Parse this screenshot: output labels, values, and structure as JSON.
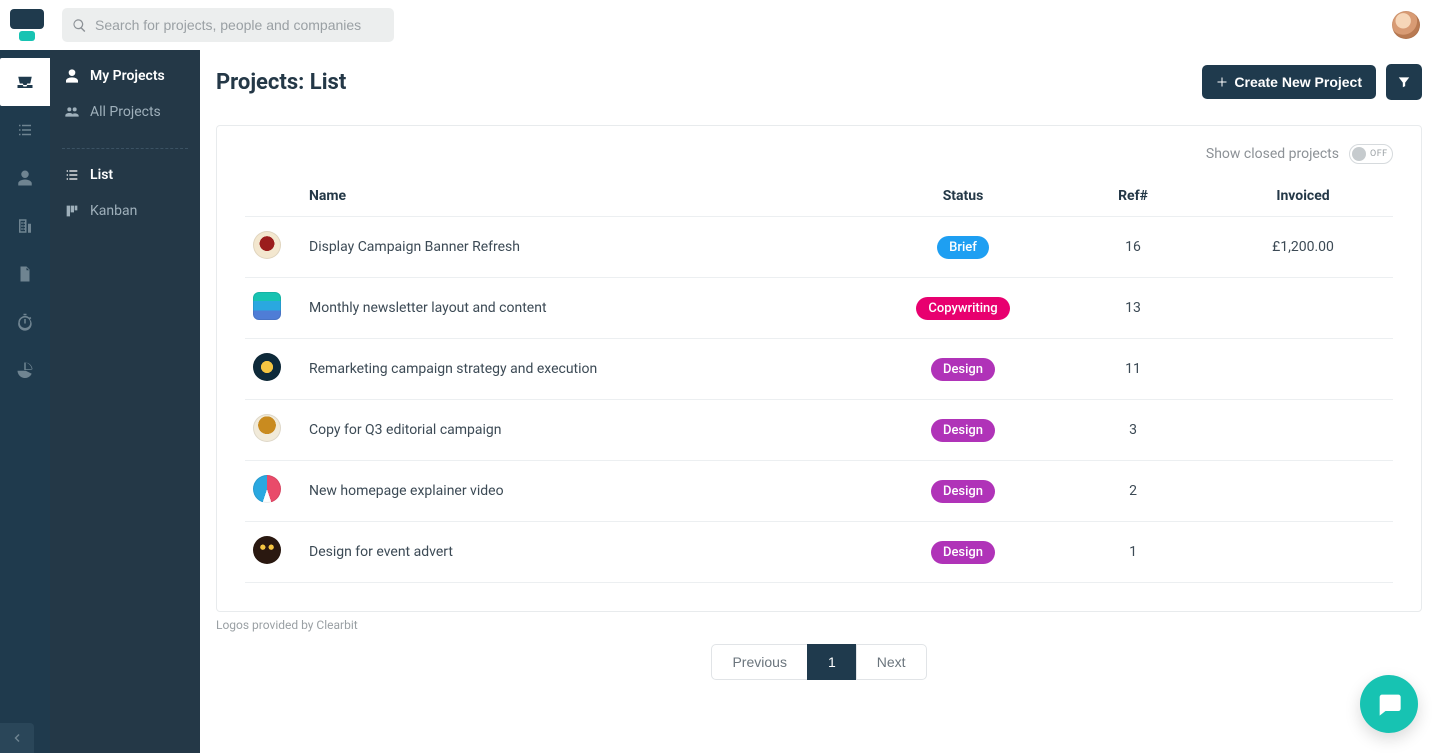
{
  "search": {
    "placeholder": "Search for projects, people and companies"
  },
  "sidebar": {
    "my_projects": "My Projects",
    "all_projects": "All Projects",
    "list": "List",
    "kanban": "Kanban"
  },
  "header": {
    "title": "Projects: List",
    "create_label": "Create New Project"
  },
  "panel": {
    "show_closed_label": "Show closed projects",
    "toggle_label": "OFF"
  },
  "table": {
    "headers": {
      "name": "Name",
      "status": "Status",
      "ref": "Ref#",
      "invoiced": "Invoiced"
    },
    "rows": [
      {
        "name": "Display Campaign Banner Refresh",
        "status": "Brief",
        "status_color": "#1e9ff2",
        "ref": "16",
        "invoiced": "£1,200.00"
      },
      {
        "name": "Monthly newsletter layout and content",
        "status": "Copywriting",
        "status_color": "#e8006f",
        "ref": "13",
        "invoiced": ""
      },
      {
        "name": "Remarketing campaign strategy and execution",
        "status": "Design",
        "status_color": "#b033b8",
        "ref": "11",
        "invoiced": ""
      },
      {
        "name": "Copy for Q3 editorial campaign",
        "status": "Design",
        "status_color": "#b033b8",
        "ref": "3",
        "invoiced": ""
      },
      {
        "name": "New homepage explainer video",
        "status": "Design",
        "status_color": "#b033b8",
        "ref": "2",
        "invoiced": ""
      },
      {
        "name": "Design for event advert",
        "status": "Design",
        "status_color": "#b033b8",
        "ref": "1",
        "invoiced": ""
      }
    ]
  },
  "footnote": "Logos provided by Clearbit",
  "pagination": {
    "previous": "Previous",
    "current": "1",
    "next": "Next"
  }
}
